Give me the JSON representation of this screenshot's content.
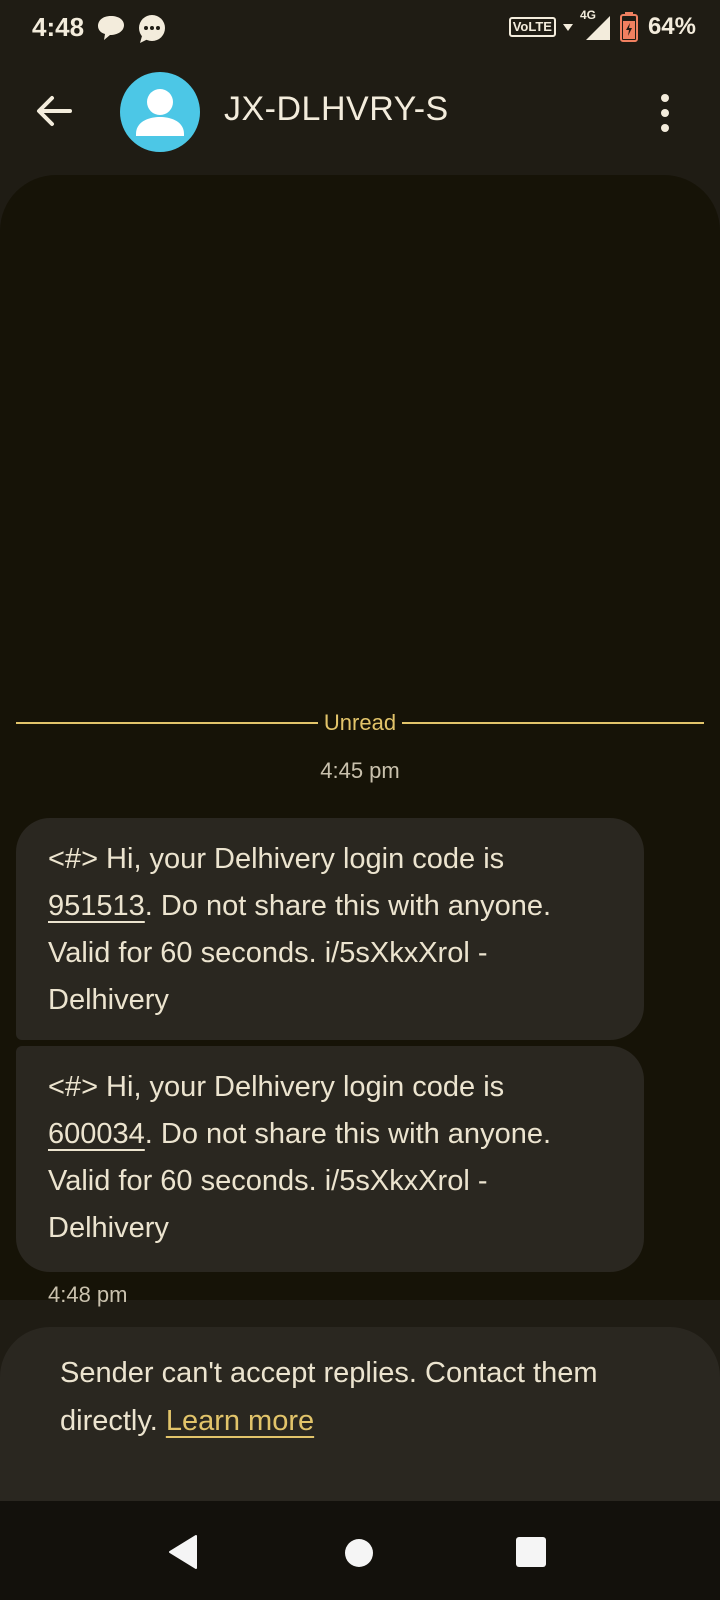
{
  "status_bar": {
    "time": "4:48",
    "network_label": "VoLTE",
    "network_type": "4G",
    "battery": "64%",
    "icons": [
      "speech-bubble-icon",
      "messages-icon",
      "volte-icon",
      "signal-icon",
      "battery-icon"
    ]
  },
  "header": {
    "contact_name": "JX-DLHVRY-S",
    "avatar_color": "#4cc7e6",
    "icons": [
      "back-arrow-icon",
      "person-icon",
      "more-vert-icon"
    ]
  },
  "conversation": {
    "unread_label": "Unread",
    "first_timestamp": "4:45 pm",
    "messages": [
      {
        "prefix": "<#> Hi, your Delhivery login code is ",
        "code": "951513",
        "suffix": ". Do not share this with anyone. Valid for 60 seconds. i/5sXkxXrol - Delhivery"
      },
      {
        "prefix": "<#> Hi, your Delhivery login code is ",
        "code": "600034",
        "suffix": ". Do not share this with anyone. Valid for 60 seconds. i/5sXkxXrol - Delhivery"
      }
    ],
    "last_timestamp": "4:48 pm"
  },
  "reply_notice": {
    "text": "Sender can't accept replies. Contact them directly. ",
    "link": "Learn more"
  },
  "nav_bar": {
    "icons": [
      "nav-back-icon",
      "nav-home-icon",
      "nav-recents-icon"
    ]
  },
  "colors": {
    "background": "#1f1c14",
    "panel": "#161307",
    "bubble": "#2a2720",
    "accent": "#e2c46a"
  }
}
